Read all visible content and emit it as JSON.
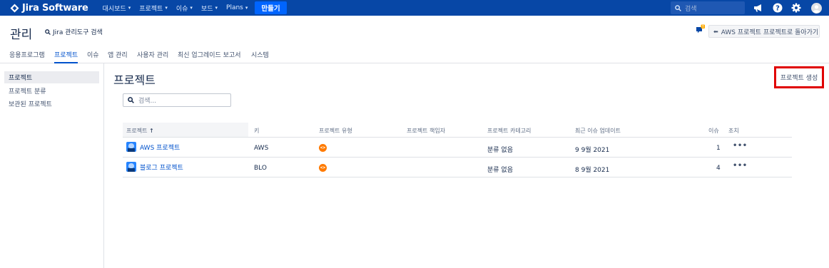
{
  "topnav": {
    "logo": "Jira Software",
    "items": [
      {
        "label": "대시보드"
      },
      {
        "label": "프로젝트"
      },
      {
        "label": "이슈"
      },
      {
        "label": "보드"
      },
      {
        "label": "Plans"
      }
    ],
    "create_label": "만들기",
    "search_placeholder": "검색"
  },
  "header": {
    "title": "관리",
    "admin_search": "Jira 관리도구 검색",
    "back_button": "AWS 프로젝트 프로젝트로 돌아가기"
  },
  "tabs": [
    "응용프로그램",
    "프로젝트",
    "이슈",
    "앱 관리",
    "사용자 관리",
    "최신 업그레이드 보고서",
    "시스템"
  ],
  "active_tab": "프로젝트",
  "sidebar": {
    "items": [
      "프로젝트",
      "프로젝트 분류",
      "보관된 프로젝트"
    ],
    "selected": "프로젝트"
  },
  "main": {
    "title": "프로젝트",
    "create_project": "프로젝트 생성",
    "search_placeholder": "검색..."
  },
  "table": {
    "columns": {
      "name": "프로젝트",
      "key": "키",
      "type": "프로젝트 유형",
      "lead": "프로젝트 책임자",
      "category": "프로젝트 카테고리",
      "updated": "최근 이슈 업데이트",
      "issues": "이슈",
      "actions": "조치"
    },
    "sort_arrow": "↑",
    "rows": [
      {
        "name": "AWS 프로젝트",
        "key": "AWS",
        "type_icon": "code-icon",
        "lead": "",
        "category": "분류 없음",
        "updated": "9 9월 2021",
        "issues": "1",
        "actions": "•••"
      },
      {
        "name": "블로그 프로젝트",
        "key": "BLO",
        "type_icon": "code-icon",
        "lead": "",
        "category": "분류 없음",
        "updated": "8 9월 2021",
        "issues": "4",
        "actions": "•••"
      }
    ]
  },
  "colors": {
    "nav_bg": "#0747a6",
    "create_btn": "#0065ff",
    "link": "#0052cc",
    "highlight_box": "#e00000",
    "software_type": "#ff7a00"
  }
}
